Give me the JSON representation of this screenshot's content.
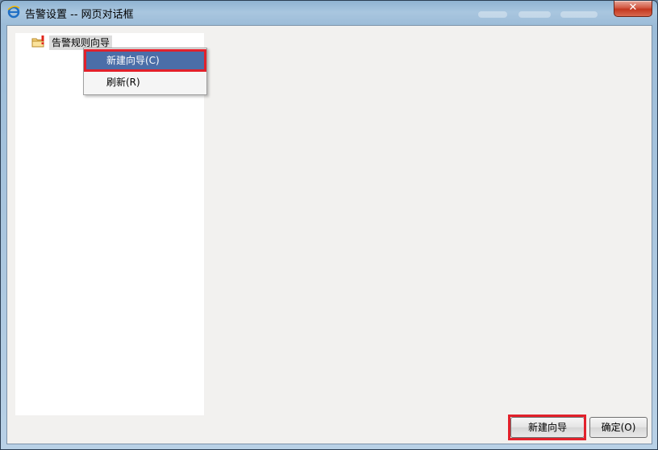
{
  "window": {
    "title": "告警设置 -- 网页对话框",
    "close_glyph": "✕",
    "title_icon": "ie-icon"
  },
  "tree": {
    "root_label": "告警规则向导",
    "root_icon": "folder-warning-icon"
  },
  "context_menu": {
    "items": [
      {
        "label": "新建向导(C)"
      },
      {
        "label": "刷新(R)"
      }
    ]
  },
  "buttons": {
    "new_wizard": "新建向导",
    "ok": "确定(O)"
  },
  "colors": {
    "menu_selected": "#4b6ea8",
    "highlight": "#e2212b",
    "close_button": "#c3371f"
  }
}
